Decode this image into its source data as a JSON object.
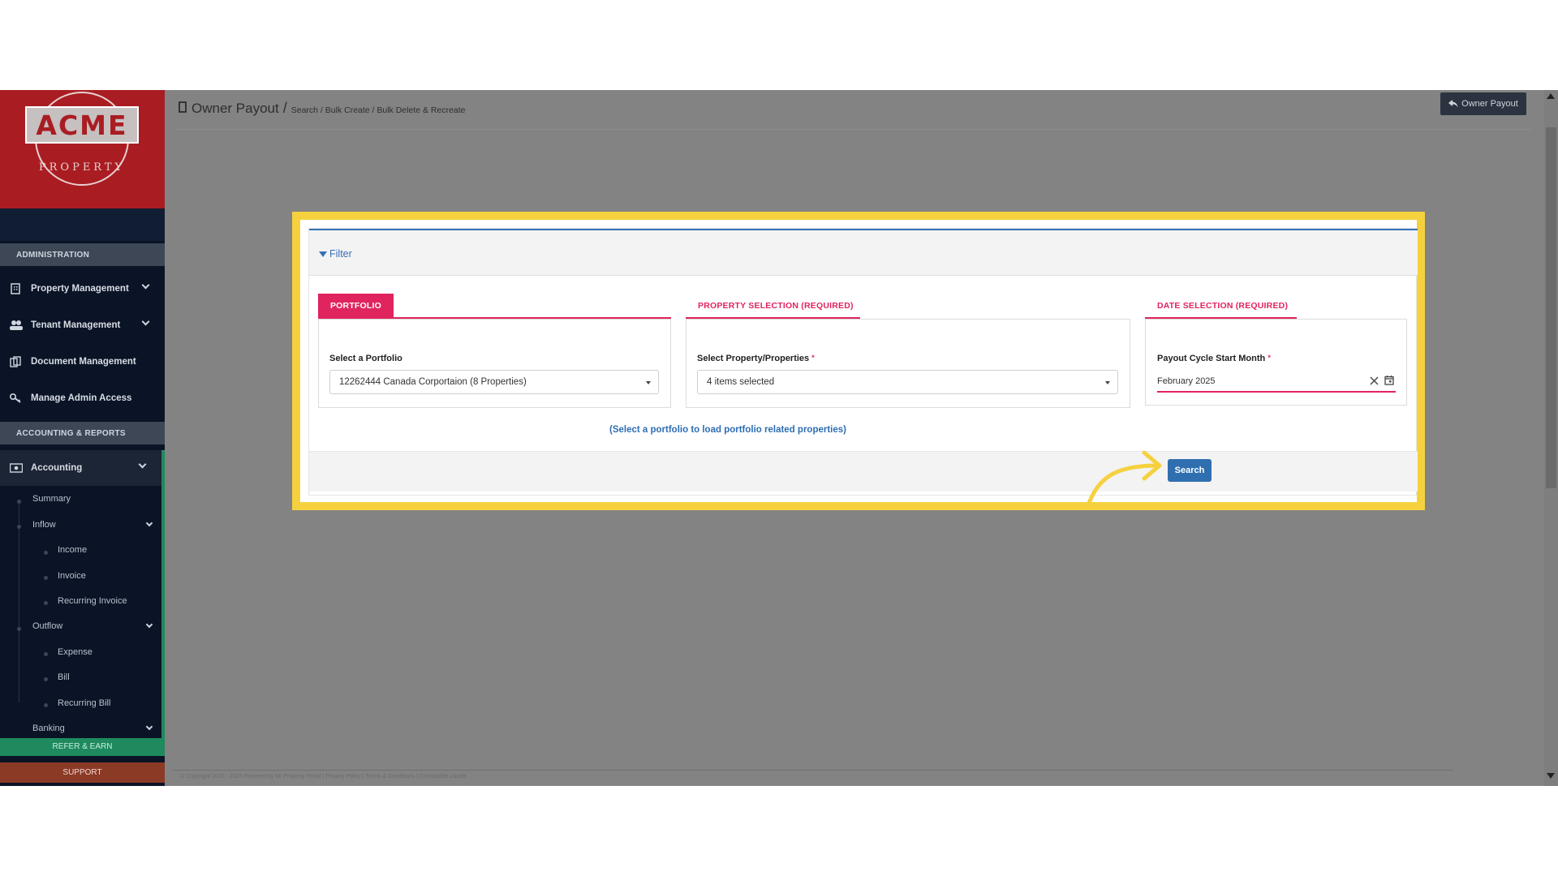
{
  "sidebar": {
    "logo": {
      "word": "ACME",
      "sub": "PROPERTY"
    },
    "sections": {
      "administration": "ADMINISTRATION",
      "accounting_reports": "ACCOUNTING & REPORTS"
    },
    "items": {
      "property_management": "Property Management",
      "tenant_management": "Tenant Management",
      "document_management": "Document Management",
      "manage_admin_access": "Manage Admin Access",
      "accounting": "Accounting"
    },
    "accounting_sub": {
      "summary": "Summary",
      "inflow": "Inflow",
      "income": "Income",
      "invoice": "Invoice",
      "recurring_invoice": "Recurring Invoice",
      "outflow": "Outflow",
      "expense": "Expense",
      "bill": "Bill",
      "recurring_bill": "Recurring Bill",
      "banking": "Banking"
    },
    "refer_earn": "REFER & EARN",
    "support": "SUPPORT",
    "colors": {
      "logo_bg": "#a91d22",
      "nav_bg": "#0b1426",
      "refer": "#1f8a5e",
      "support": "#8b3a26"
    }
  },
  "header": {
    "title": "Owner Payout",
    "separator": "/",
    "breadcrumb": "Search / Bulk Create / Bulk Delete & Recreate",
    "owner_payout_button": "Owner Payout"
  },
  "filter": {
    "label": "Filter",
    "tabs": {
      "portfolio": "PORTFOLIO",
      "property_selection": "PROPERTY SELECTION (REQUIRED)",
      "date_selection": "DATE SELECTION (REQUIRED)"
    },
    "portfolio_label": "Select a Portfolio",
    "portfolio_value": "12262444 Canada Corportaion (8 Properties)",
    "property_label": "Select Property/Properties",
    "property_value": "4 items selected",
    "date_label": "Payout Cycle Start Month",
    "date_value": "February 2025",
    "required_mark": "*",
    "hint": "(Select a portfolio to load portfolio related properties)",
    "search_button": "Search",
    "accent_color": "#e0245e",
    "highlight_color": "#f5d13e"
  },
  "footer": {
    "text": "© Copyright 2016 - 2025 Powered by MI Property Portal | Privacy Policy | Terms & Conditions | Compatible Locale"
  }
}
